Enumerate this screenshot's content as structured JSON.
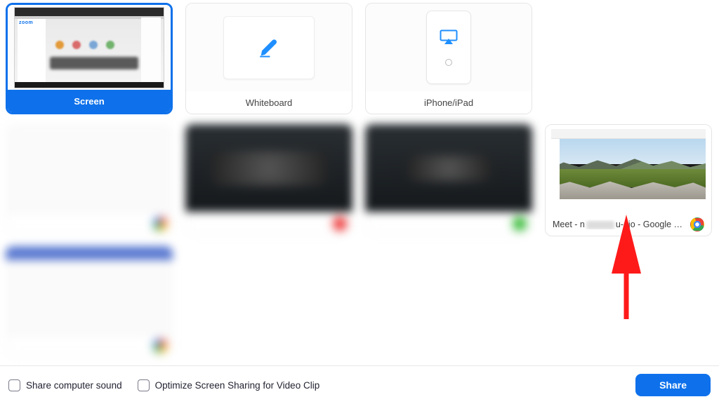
{
  "sources": {
    "screen": {
      "label": "Screen"
    },
    "whiteboard": {
      "label": "Whiteboard"
    },
    "iphone_ipad": {
      "label": "iPhone/iPad"
    }
  },
  "windows": {
    "meet_chrome": {
      "label_prefix": "Meet - n",
      "label_suffix": "u-gjo - Google C…",
      "app_icon": "chrome-icon"
    }
  },
  "footer": {
    "share_sound_label": "Share computer sound",
    "optimize_clip_label": "Optimize Screen Sharing for Video Clip",
    "share_button_label": "Share"
  },
  "colors": {
    "accent": "#0e71eb"
  }
}
